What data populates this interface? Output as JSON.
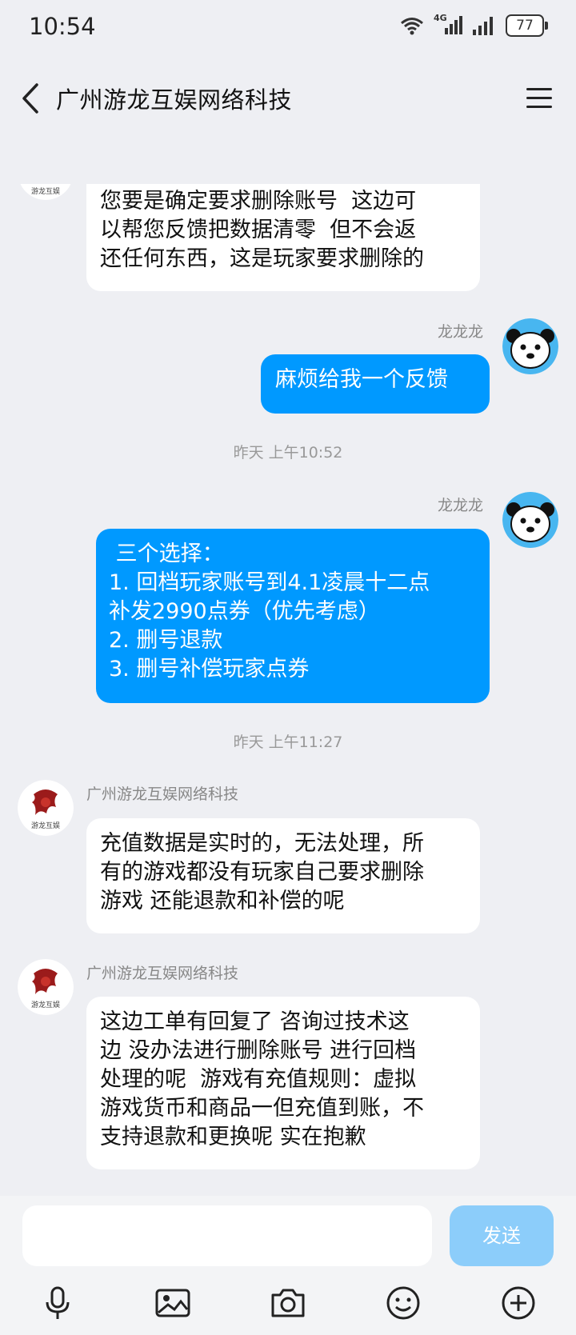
{
  "status_bar": {
    "time": "10:54",
    "network": "4G",
    "battery": "77"
  },
  "header": {
    "title": "广州游龙互娱网络科技"
  },
  "messages": {
    "m1": {
      "text": "您要是确定要求删除账号  这边可\n以帮您反馈把数据清零  但不会返\n还任何东西，这是玩家要求删除的"
    },
    "m2": {
      "sender": "龙龙龙",
      "text": "麻烦给我一个反馈"
    },
    "ts1": "昨天 上午10:52",
    "m3": {
      "sender": "龙龙龙",
      "text": " 三个选择：\n1. 回档玩家账号到4.1凌晨十二点\n补发2990点券（优先考虑）\n2. 删号退款\n3. 删号补偿玩家点券"
    },
    "ts2": "昨天 上午11:27",
    "m4": {
      "sender": "广州游龙互娱网络科技",
      "text": "充值数据是实时的，无法处理，所\n有的游戏都没有玩家自己要求删除\n游戏 还能退款和补偿的呢"
    },
    "m5": {
      "sender": "广州游龙互娱网络科技",
      "text": "这边工单有回复了 咨询过技术这\n边 没办法进行删除账号 进行回档\n处理的呢  游戏有充值规则：虚拟\n游戏货币和商品一但充值到账，不\n支持退款和更换呢 实在抱歉"
    }
  },
  "input_bar": {
    "send_label": "发送"
  },
  "toolbar": [
    "mic-icon",
    "image-icon",
    "camera-icon",
    "emoji-icon",
    "plus-icon"
  ],
  "colors": {
    "my_bubble": "#0099ff",
    "send_button": "#8ccdfa",
    "background": "#eeeff3"
  }
}
